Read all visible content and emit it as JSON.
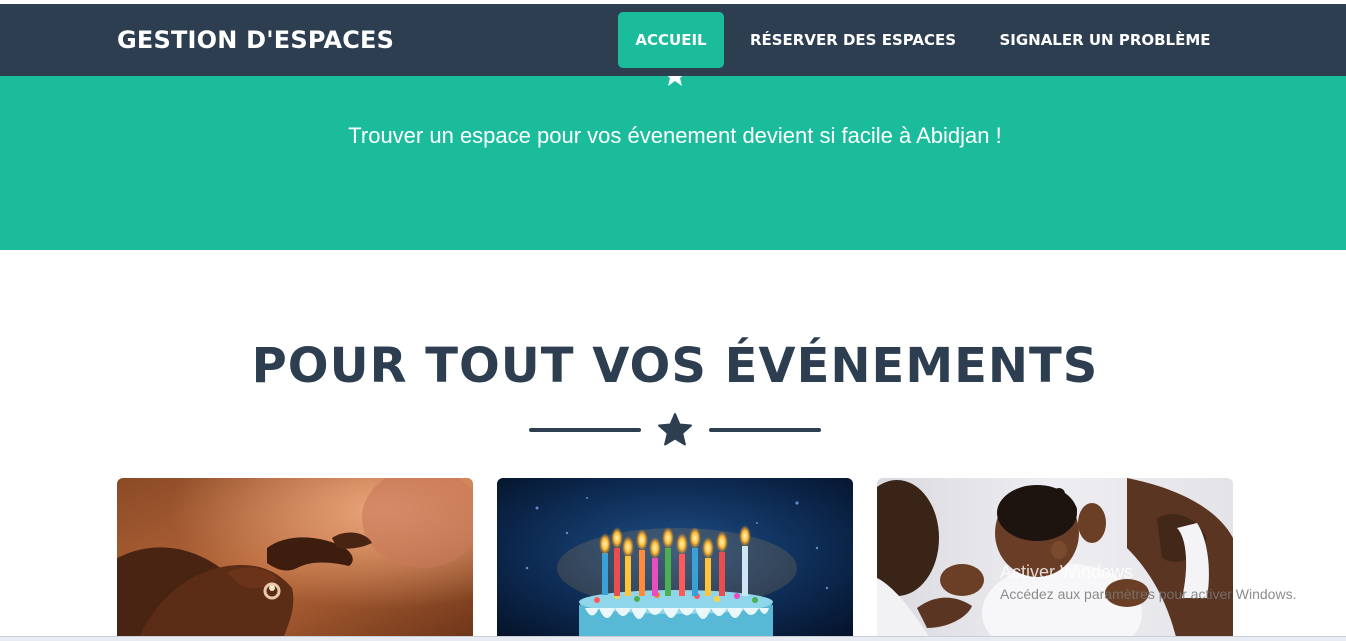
{
  "navbar": {
    "brand": "GESTION D'ESPACES",
    "items": [
      {
        "label": "ACCUEIL",
        "active": true
      },
      {
        "label": "RÉSERVER DES ESPACES",
        "active": false
      },
      {
        "label": "SIGNALER UN PROBLÈME",
        "active": false
      }
    ]
  },
  "hero": {
    "tagline": "Trouver un espace pour vos évenement devient si facile à Abidjan !"
  },
  "section": {
    "title": "POUR TOUT VOS ÉVÉNEMENTS",
    "divider_icon": "star-icon"
  },
  "cards": [
    {
      "image": "wedding-ring-photo"
    },
    {
      "image": "birthday-cake-photo"
    },
    {
      "image": "baby-family-photo"
    }
  ],
  "watermark": {
    "title": "Activer Windows",
    "subtitle": "Accédez aux paramètres pour activer Windows."
  },
  "colors": {
    "navbar": "#2c3e50",
    "accent": "#1abc9c",
    "text_dark": "#2c3e50",
    "white": "#ffffff"
  }
}
